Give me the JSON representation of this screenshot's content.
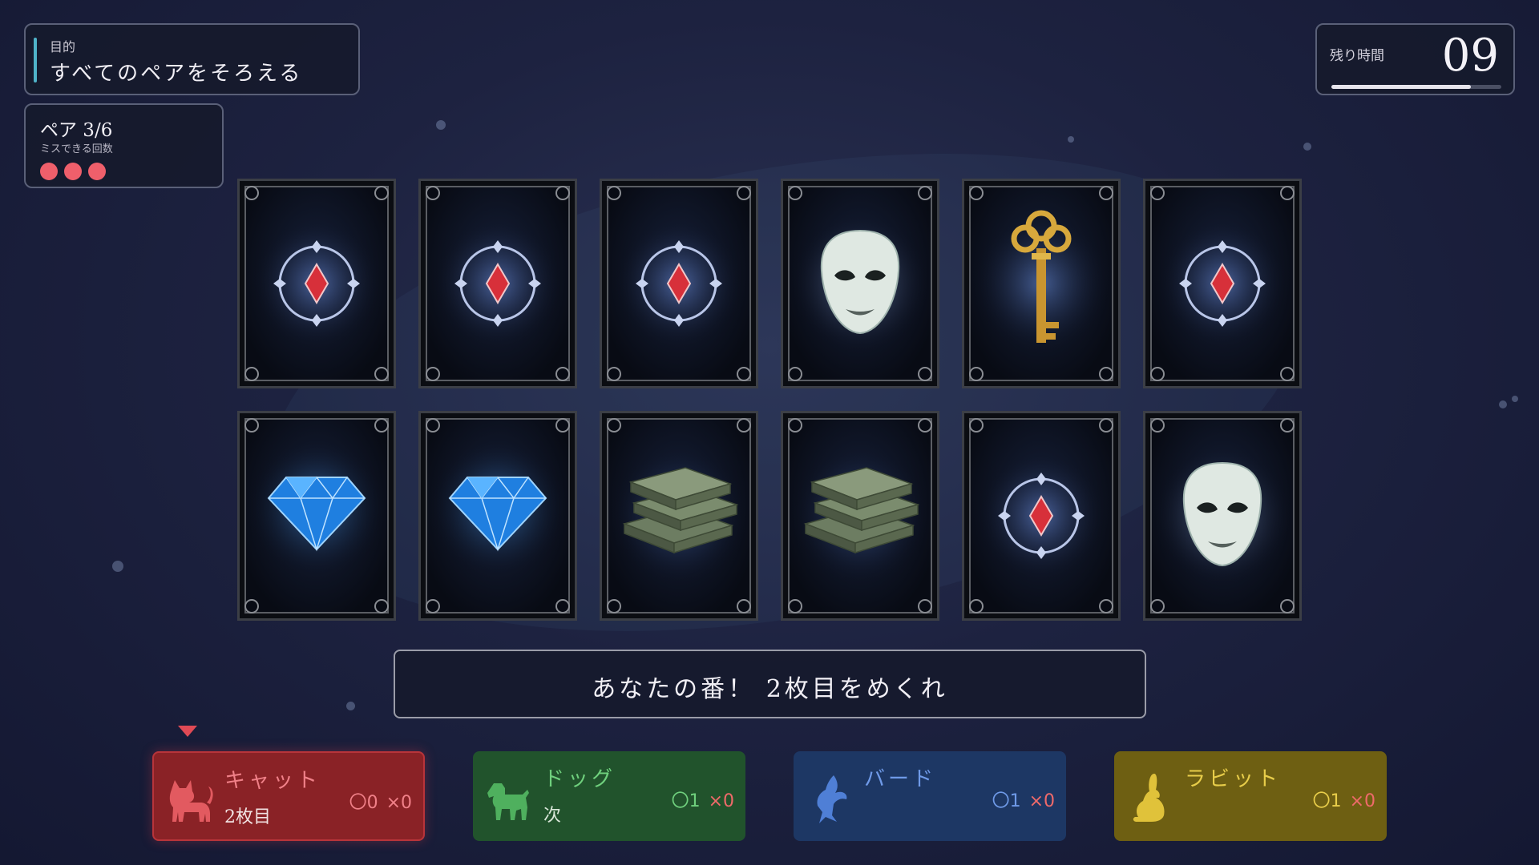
{
  "objective": {
    "label": "目的",
    "text": "すべてのペアをそろえる"
  },
  "pairs": {
    "count": "ペア 3/6",
    "misses_label": "ミスできる回数",
    "lives_remaining": 3
  },
  "timer": {
    "label": "残り時間",
    "value": "09",
    "progress": 0.82
  },
  "board": {
    "rows": 2,
    "cols": 6,
    "cards": [
      {
        "face": "back"
      },
      {
        "face": "back"
      },
      {
        "face": "back"
      },
      {
        "face": "mask"
      },
      {
        "face": "key"
      },
      {
        "face": "back"
      },
      {
        "face": "diamond"
      },
      {
        "face": "diamond"
      },
      {
        "face": "money"
      },
      {
        "face": "money"
      },
      {
        "face": "back"
      },
      {
        "face": "mask"
      }
    ]
  },
  "message": "あなたの番！ 2枚目をめくれ",
  "players": {
    "cat": {
      "name": "キャット",
      "status": "2枚目",
      "ok": "〇0",
      "ng": "×0",
      "color": "#8a2226",
      "icon": "cat-icon"
    },
    "dog": {
      "name": "ドッグ",
      "status": "次",
      "ok": "〇1",
      "ng": "×0",
      "color": "#21532c",
      "icon": "dog-icon"
    },
    "bird": {
      "name": "バード",
      "status": "",
      "ok": "〇1",
      "ng": "×0",
      "color": "#1d3764",
      "icon": "bird-icon"
    },
    "rabbit": {
      "name": "ラビット",
      "status": "",
      "ok": "〇1",
      "ng": "×0",
      "color": "#6e5f12",
      "icon": "rabbit-icon"
    }
  },
  "current_player": "cat"
}
